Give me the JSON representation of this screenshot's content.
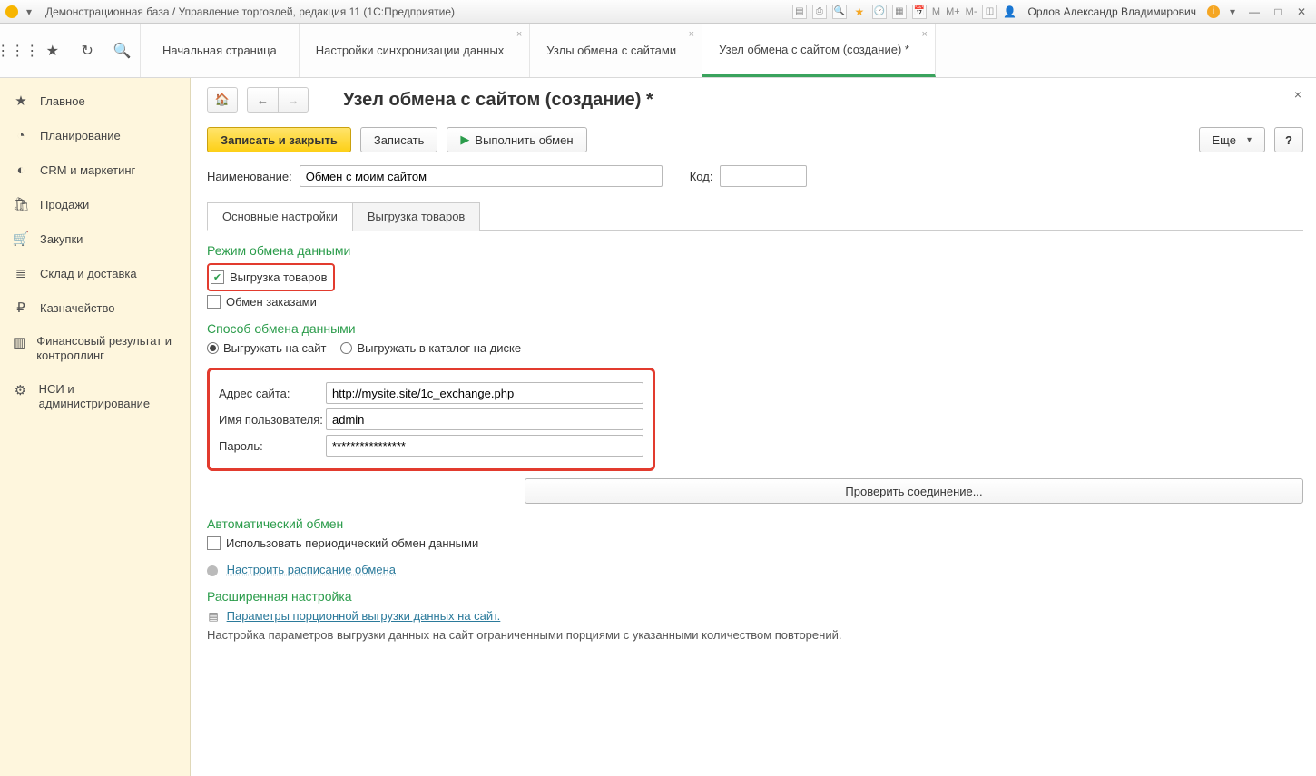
{
  "titlebar": {
    "title": "Демонстрационная база / Управление торговлей, редакция 11 (1С:Предприятие)",
    "user": "Орлов Александр Владимирович",
    "m": "M",
    "mplus": "M+",
    "mminus": "M-"
  },
  "tabs": {
    "home": "Начальная страница",
    "sync": "Настройки синхронизации данных",
    "nodes": "Узлы обмена с сайтами",
    "active": "Узел обмена с сайтом (создание) *"
  },
  "sidebar": [
    {
      "icon": "★",
      "label": "Главное"
    },
    {
      "icon": "◔",
      "label": "Планирование"
    },
    {
      "icon": "◐",
      "label": "CRM и маркетинг"
    },
    {
      "icon": "🛍",
      "label": "Продажи"
    },
    {
      "icon": "🛒",
      "label": "Закупки"
    },
    {
      "icon": "≣",
      "label": "Склад и доставка"
    },
    {
      "icon": "₽",
      "label": "Казначейство"
    },
    {
      "icon": "▥",
      "label": "Финансовый результат и контроллинг",
      "multi": true
    },
    {
      "icon": "⚙",
      "label": "НСИ и администрирование",
      "multi": true
    }
  ],
  "page": {
    "title": "Узел обмена с сайтом (создание) *",
    "saveClose": "Записать и закрыть",
    "save": "Записать",
    "runExchange": "Выполнить обмен",
    "more": "Еще",
    "help": "?",
    "nameLabel": "Наименование:",
    "nameValue": "Обмен с моим сайтом",
    "codeLabel": "Код:",
    "codeValue": ""
  },
  "innerTabs": {
    "main": "Основные настройки",
    "goods": "Выгрузка товаров"
  },
  "sec1": {
    "title": "Режим обмена данными",
    "chk1": "Выгрузка товаров",
    "chk2": "Обмен заказами"
  },
  "sec2": {
    "title": "Способ обмена данными",
    "r1": "Выгружать на сайт",
    "r2": "Выгружать в каталог на диске",
    "addrLabel": "Адрес сайта:",
    "addrValue": "http://mysite.site/1c_exchange.php",
    "userLabel": "Имя пользователя:",
    "userValue": "admin",
    "passLabel": "Пароль:",
    "passValue": "****************",
    "testBtn": "Проверить соединение..."
  },
  "sec3": {
    "title": "Автоматический обмен",
    "chk": "Использовать периодический обмен данными",
    "link": "Настроить расписание обмена"
  },
  "sec4": {
    "title": "Расширенная настройка",
    "link": "Параметры порционной выгрузки данных на сайт.",
    "hint": "Настройка параметров выгрузки данных на сайт ограниченными порциями с указанными количеством повторений."
  }
}
